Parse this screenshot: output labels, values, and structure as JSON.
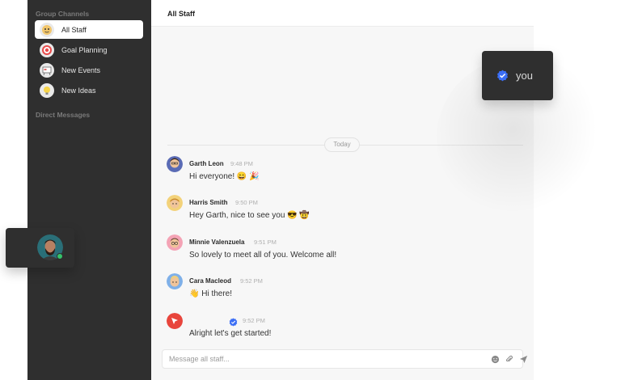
{
  "sidebar": {
    "group_title": "Group Channels",
    "direct_title": "Direct Messages",
    "channels": [
      {
        "label": "All Staff",
        "icon": "staff-icon",
        "active": true
      },
      {
        "label": "Goal Planning",
        "icon": "target-icon",
        "active": false
      },
      {
        "label": "New Events",
        "icon": "events-board-icon",
        "active": false
      },
      {
        "label": "New Ideas",
        "icon": "lightbulb-icon",
        "active": false
      }
    ]
  },
  "main": {
    "title": "All Staff",
    "day_divider": "Today",
    "messages": [
      {
        "name": "Garth Leon",
        "time": "9:48 PM",
        "text": "Hi everyone! 😄 🎉"
      },
      {
        "name": "Harris Smith",
        "time": "9:50 PM",
        "text": "Hey Garth, nice to see you 😎 🤠"
      },
      {
        "name": "Minnie Valenzuela",
        "time": "9:51 PM",
        "text": "So lovely to meet all of you. Welcome all!"
      },
      {
        "name": "Cara Macleod",
        "time": "9:52 PM",
        "text": "👋  Hi there!"
      },
      {
        "name": "",
        "time": "9:52 PM",
        "text": "Alright let's get started!"
      }
    ],
    "composer": {
      "placeholder": "Message all staff...",
      "icons": [
        "emoji-icon",
        "attach-icon",
        "send-icon"
      ]
    }
  },
  "you_card": {
    "label": "you",
    "icon": "verified-check-icon"
  },
  "user_card": {
    "status": "online"
  },
  "colors": {
    "sidebar_bg": "#2f2f2f",
    "main_bg": "#f7f7f7",
    "verified_blue": "#3b6ef5",
    "online_green": "#35c46a",
    "brand_red": "#e8453c"
  }
}
